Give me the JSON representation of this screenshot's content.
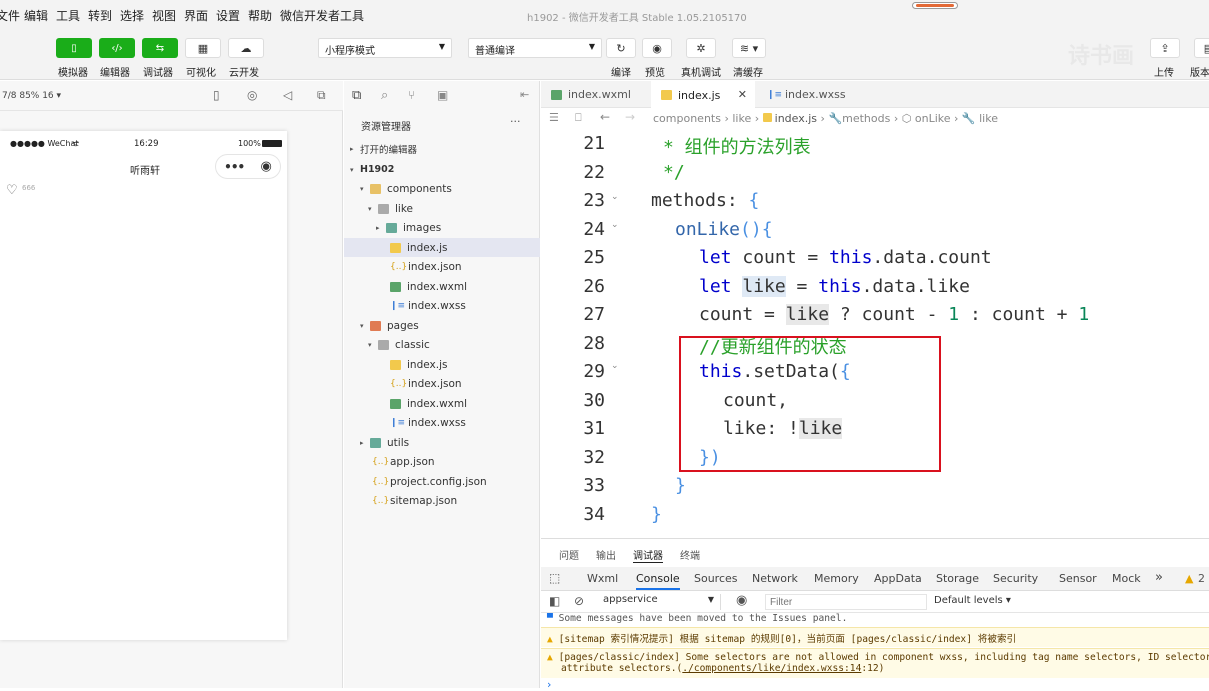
{
  "menu": {
    "items": [
      "文件",
      "编辑",
      "工具",
      "转到",
      "选择",
      "视图",
      "界面",
      "设置",
      "帮助",
      "微信开发者工具"
    ],
    "window_title": "h1902 - 微信开发者工具 Stable 1.05.2105170"
  },
  "toolbar": {
    "simulator": "模拟器",
    "editor": "编辑器",
    "debugger": "调试器",
    "visual": "可视化",
    "cloud": "云开发",
    "mode_select": "小程序模式",
    "compile_select": "普通编译",
    "compile": "编译",
    "preview": "预览",
    "real_debug": "真机调试",
    "clear_cache": "清缓存",
    "upload": "上传",
    "version": "版本",
    "watermark": "诗书画"
  },
  "simulator": {
    "device": "7/8 85% 16 ▾",
    "carrier": "●●●●● WeChat",
    "time": "16:29",
    "battery": "100%",
    "page_title": "听雨轩",
    "like_count": "666"
  },
  "explorer": {
    "title": "资源管理器",
    "more": "···",
    "open_editors": "打开的编辑器",
    "project": "H1902",
    "tree": {
      "components": "components",
      "like": "like",
      "images": "images",
      "like_js": "index.js",
      "like_json": "index.json",
      "like_wxml": "index.wxml",
      "like_wxss": "index.wxss",
      "pages": "pages",
      "classic": "classic",
      "classic_js": "index.js",
      "classic_json": "index.json",
      "classic_wxml": "index.wxml",
      "classic_wxss": "index.wxss",
      "utils": "utils",
      "app_json": "app.json",
      "project_config": "project.config.json",
      "sitemap": "sitemap.json"
    }
  },
  "editor": {
    "tabs": [
      "index.wxml",
      "index.js",
      "index.wxss"
    ],
    "active_tab": "index.js",
    "breadcrumb": {
      "c1": "components",
      "c2": "like",
      "c3": "index.js",
      "c4": "methods",
      "c5": "onLike",
      "c6": "like"
    },
    "line_numbers": [
      "21",
      "22",
      "23",
      "24",
      "25",
      "26",
      "27",
      "28",
      "29",
      "30",
      "31",
      "32",
      "33",
      "34"
    ],
    "code": {
      "l21": "* 组件的方法列表",
      "l22": "*/",
      "l23_a": "methods",
      "l23_b": ": ",
      "l23_c": "{",
      "l24_a": "onLike",
      "l24_b": "(){",
      "l25_a": "let",
      "l25_b": " count = ",
      "l25_c": "this",
      "l25_d": ".data.count",
      "l26_a": "let",
      "l26_b": " ",
      "l26_c": "like",
      "l26_d": " = ",
      "l26_e": "this",
      "l26_f": ".data.like",
      "l27_a": "count = ",
      "l27_b": "like",
      "l27_c": " ? count - ",
      "l27_d": "1",
      "l27_e": " : count + ",
      "l27_f": "1",
      "l28": "//更新组件的状态",
      "l29_a": "this",
      "l29_b": ".setData(",
      "l29_c": "{",
      "l30": "count,",
      "l31_a": "like: !",
      "l31_b": "like",
      "l32_a": "}",
      "l32_b": ")",
      "l33": "}",
      "l34": "}"
    }
  },
  "bottom": {
    "top_tabs": [
      "问题",
      "输出",
      "调试器",
      "终端"
    ],
    "tabs": [
      "Wxml",
      "Console",
      "Sources",
      "Network",
      "Memory",
      "AppData",
      "Storage",
      "Security",
      "Sensor",
      "Mock"
    ],
    "active_tab": "Console",
    "more": "»",
    "warn_count": "2",
    "context": "appservice",
    "filter_placeholder": "Filter",
    "levels": "Default levels ▾",
    "msg1": "Some messages have been moved to the Issues panel.",
    "msg2": "[sitemap 索引情况提示] 根据 sitemap 的规则[0]，当前页面 [pages/classic/index] 将被索引",
    "msg3": "[pages/classic/index] Some selectors are not allowed in component wxss, including tag name selectors, ID selectors,",
    "msg3b_pre": "attribute selectors.(",
    "msg3b_link": "./components/like/index.wxss:14",
    "msg3b_post": ":12)",
    "prompt": "›"
  },
  "colors": {
    "accent_green": "#1aad19",
    "highlight_box": "#d9111e",
    "keyword": "#0000cc",
    "comment": "#2aa12a"
  }
}
